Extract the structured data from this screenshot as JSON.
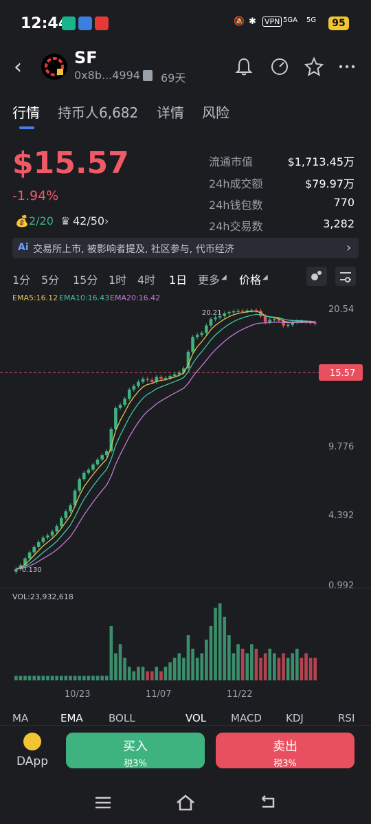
{
  "status_bar": {
    "time": "12:44",
    "indicators": [
      "VPN",
      "5GA",
      "5G"
    ],
    "battery": "95"
  },
  "header": {
    "token_name": "SF",
    "address": "0x8b...4994",
    "age": "69天",
    "icons": [
      "bell-icon",
      "gauge-icon",
      "star-icon",
      "more-icon"
    ]
  },
  "tabs": [
    "行情",
    "持币人6,682",
    "详情",
    "风险"
  ],
  "price": {
    "value": "$15.57",
    "change": "-1.94%"
  },
  "tags": {
    "bag": "2/20",
    "crown": "42/50"
  },
  "stats": [
    {
      "label": "流通市值",
      "value": "$1,713.45万"
    },
    {
      "label": "24h成交额",
      "value": "$79.97万"
    },
    {
      "label": "24h钱包数",
      "value": "770"
    },
    {
      "label": "24h交易数",
      "value": "3,282"
    }
  ],
  "ai_bar": {
    "badge": "Ai",
    "text": "交易所上市, 被影响者提及, 社区参与, 代币经济"
  },
  "timeframes": [
    "1分",
    "5分",
    "15分",
    "1时",
    "4时",
    "1日",
    "更多",
    "价格"
  ],
  "active_timeframe": "1日",
  "ema": {
    "ema5": "EMA5:16.12",
    "ema10": "EMA10:16.43",
    "ema20": "EMA20:16.42"
  },
  "chart_data": {
    "type": "candlestick",
    "y_ticks": [
      "20.54",
      "9.776",
      "4.392",
      "0.992"
    ],
    "current_price_label": "15.57",
    "high_label": "20.21",
    "low_label": "0.130",
    "x_ticks": [
      "10/23",
      "11/07",
      "11/22"
    ],
    "volume_label": "VOL:23,932,618",
    "close_series": [
      0.13,
      0.14,
      0.16,
      0.18,
      0.2,
      0.22,
      0.24,
      0.25,
      0.27,
      0.3,
      0.35,
      0.4,
      0.45,
      0.6,
      0.75,
      0.85,
      0.9,
      1.0,
      1.1,
      1.2,
      1.3,
      2.0,
      3.0,
      3.2,
      3.6,
      4.3,
      4.6,
      5.0,
      5.3,
      5.2,
      5.0,
      5.5,
      5.3,
      5.4,
      5.6,
      5.8,
      6.0,
      6.5,
      9.0,
      12.0,
      12.5,
      13.0,
      15.0,
      17.0,
      17.5,
      18.0,
      19.0,
      19.5,
      19.8,
      20.0,
      19.9,
      20.1,
      20.2,
      20.0,
      18.0,
      16.0,
      16.8,
      17.0,
      16.5,
      15.0,
      15.2,
      16.0,
      16.3,
      16.2,
      16.0,
      15.9,
      15.57
    ],
    "volume_series": [
      1,
      1,
      1,
      1,
      1,
      1,
      1,
      1,
      1,
      1,
      1,
      1,
      1,
      1,
      1,
      1,
      1,
      1,
      1,
      1,
      1,
      12,
      6,
      8,
      5,
      3,
      2,
      3,
      3,
      2,
      2,
      3,
      2,
      3,
      4,
      5,
      6,
      5,
      10,
      7,
      5,
      6,
      9,
      12,
      16,
      17,
      14,
      10,
      6,
      8,
      7,
      6,
      8,
      7,
      5,
      6,
      7,
      6,
      5,
      6,
      5,
      6,
      7,
      5,
      6,
      5,
      5
    ]
  },
  "indicator_tabs": [
    "MA",
    "EMA",
    "BOLL",
    "VOL",
    "MACD",
    "KDJ",
    "RSI"
  ],
  "bottom": {
    "dapp": "DApp",
    "buy": "买入",
    "buy_tax": "税3%",
    "sell": "卖出",
    "sell_tax": "税3%"
  }
}
